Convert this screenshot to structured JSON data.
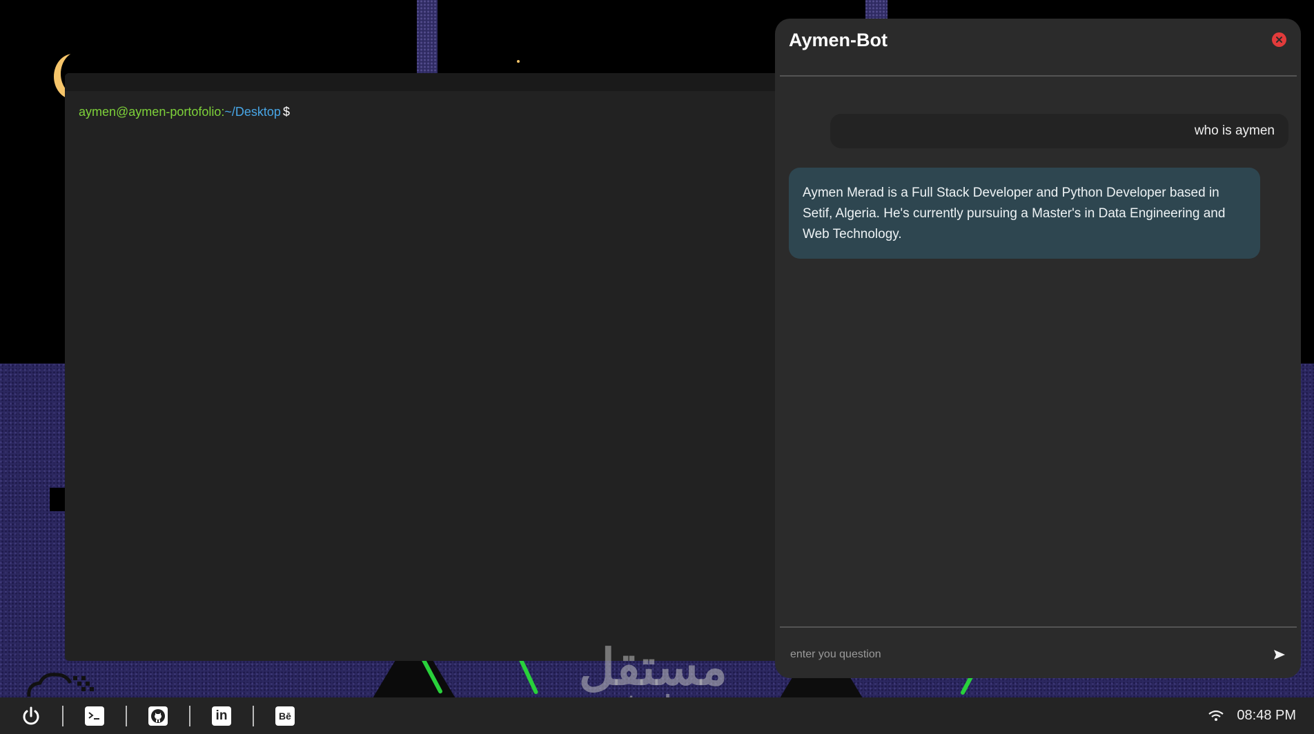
{
  "terminal": {
    "prompt_user": "aymen@aymen-portofolio",
    "prompt_sep": ":",
    "prompt_path": "~/Desktop",
    "prompt_dollar": "$"
  },
  "chat": {
    "title": "Aymen-Bot",
    "close_icon": "close-icon",
    "messages": [
      {
        "role": "user",
        "text": "who is aymen"
      },
      {
        "role": "bot",
        "text": "Aymen Merad is a Full Stack Developer and Python Developer based in Setif, Algeria. He's currently pursuing a Master's in Data Engineering and Web Technology."
      }
    ],
    "input_placeholder": "enter you question",
    "send_icon": "send-icon"
  },
  "watermark": {
    "arabic": "مستقل",
    "latin": "mostaql.com"
  },
  "taskbar": {
    "items": [
      {
        "name": "power",
        "icon": "power-icon"
      },
      {
        "name": "terminal",
        "icon": "terminal-icon"
      },
      {
        "name": "github",
        "icon": "github-icon"
      },
      {
        "name": "linkedin",
        "icon": "linkedin-icon",
        "label": "in"
      },
      {
        "name": "behance",
        "icon": "behance-icon",
        "label": "Bē"
      }
    ],
    "wifi_icon": "wifi-icon",
    "clock": "08:48 PM"
  },
  "colors": {
    "accent_green": "#7ed23a",
    "accent_blue": "#48a6e6",
    "close_red": "#e23b3b",
    "bot_bubble": "#2e4650",
    "moon": "#f6c56a"
  }
}
